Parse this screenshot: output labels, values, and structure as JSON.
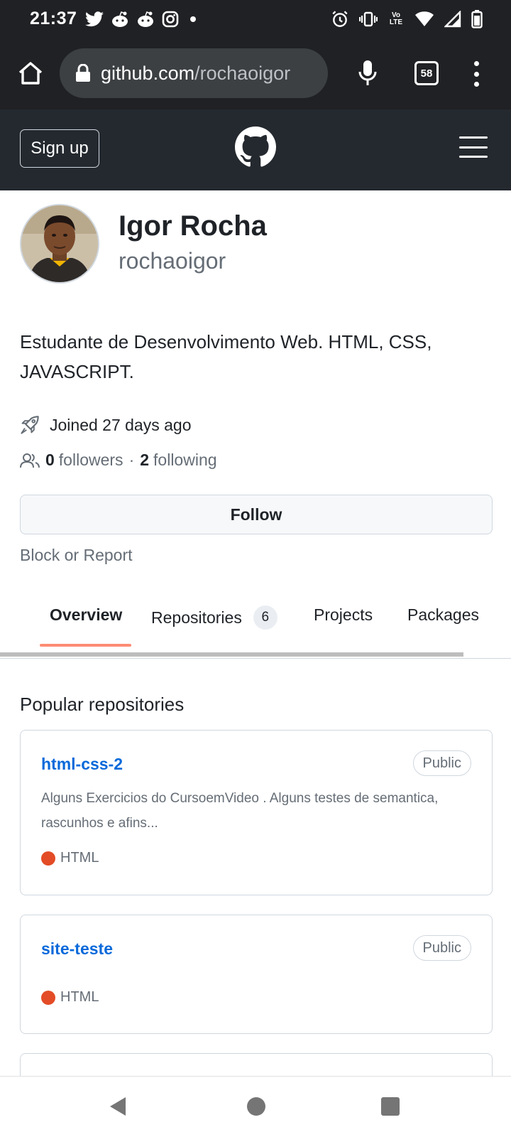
{
  "status_bar": {
    "time": "21:37",
    "left_icons": [
      "twitter-icon",
      "reddit-icon",
      "reddit-icon",
      "instagram-icon",
      "dot-icon"
    ],
    "right_icons": [
      "alarm-icon",
      "vibrate-icon",
      "volte-icon",
      "wifi-icon",
      "signal-icon",
      "battery-icon"
    ],
    "volte_label": "Vo LTE"
  },
  "browser": {
    "url_host": "github.com",
    "url_path": "/rochaoigor",
    "tab_count": "58"
  },
  "header": {
    "signup_label": "Sign up"
  },
  "profile": {
    "name": "Igor Rocha",
    "username": "rochaoigor",
    "bio": "Estudante de Desenvolvimento Web. HTML, CSS, JAVASCRIPT.",
    "joined": "Joined 27 days ago",
    "followers_count": "0",
    "followers_label": "followers",
    "separator": "·",
    "following_count": "2",
    "following_label": "following",
    "follow_label": "Follow",
    "block_label": "Block or Report"
  },
  "tabs": {
    "overview": "Overview",
    "repositories": "Repositories",
    "repositories_count": "6",
    "projects": "Projects",
    "packages": "Packages",
    "active": "Overview"
  },
  "popular": {
    "title": "Popular repositories",
    "repos": [
      {
        "name": "html-css-2",
        "visibility": "Public",
        "description": "Alguns Exercicios do CursoemVideo . Alguns testes de semantica, rascunhos e afins...",
        "language": "HTML",
        "language_color": "#e34c26"
      },
      {
        "name": "site-teste",
        "visibility": "Public",
        "language": "HTML",
        "language_color": "#e34c26"
      }
    ]
  },
  "colors": {
    "link": "#0969da",
    "header_bg": "#24292f",
    "browser_bg": "#202124",
    "tab_underline": "#fd8c73"
  }
}
